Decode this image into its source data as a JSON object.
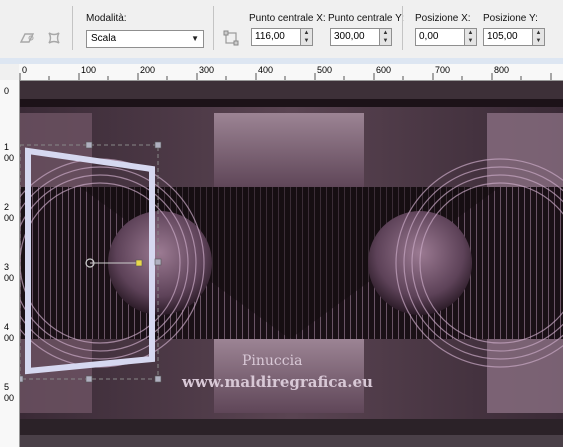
{
  "toolbar": {
    "mode_label": "Modalità:",
    "mode_value": "Scala",
    "center_x_label": "Punto centrale X:",
    "center_x_value": "116,00",
    "center_y_label": "Punto centrale Y:",
    "center_y_value": "300,00",
    "pos_x_label": "Posizione X:",
    "pos_x_value": "0,00",
    "pos_y_label": "Posizione Y:",
    "pos_y_value": "105,00",
    "icons": [
      "perspective-icon",
      "mesh-icon",
      "deform-icon"
    ]
  },
  "ruler": {
    "h_labels": [
      "0",
      "100",
      "200",
      "300",
      "400",
      "500",
      "600",
      "700",
      "800"
    ],
    "v_labels": [
      "0",
      "1",
      "00",
      "2",
      "00",
      "3",
      "00",
      "4",
      "00",
      "5",
      "00"
    ]
  },
  "watermark": {
    "line1": "Pinuccia",
    "line2": "www.maldiregrafica.eu"
  },
  "colors": {
    "canvas_dark": "#241820",
    "mauve": "#7a5a70",
    "selection_frame": "#d6d8f0"
  }
}
